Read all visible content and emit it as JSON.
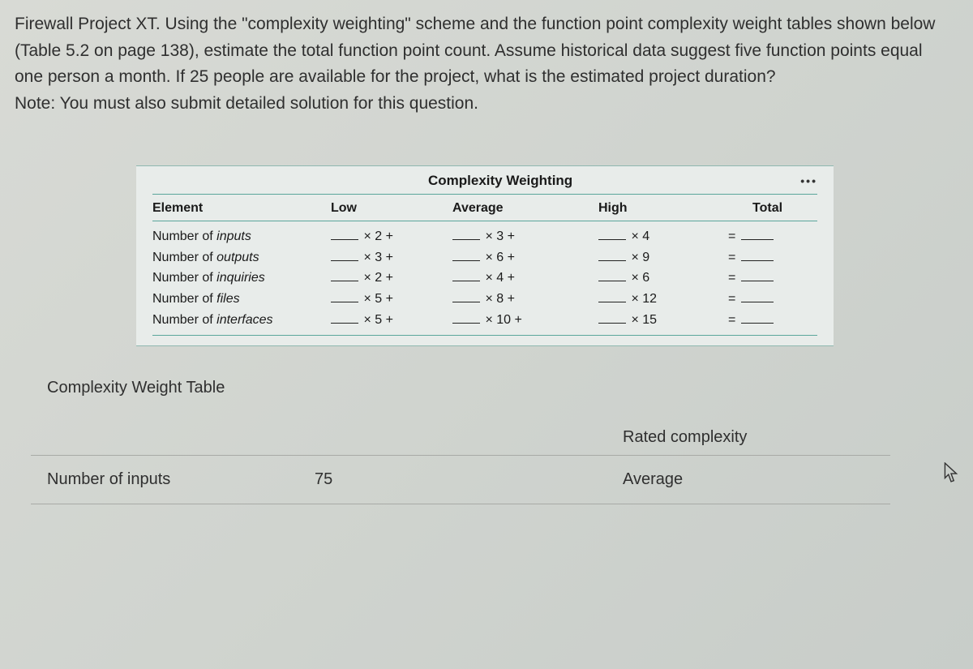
{
  "question": {
    "text": "Firewall Project XT. Using the \"complexity weighting\" scheme and the function point complexity weight tables shown below (Table 5.2 on page 138), estimate the total function point count. Assume historical data suggest five function points equal one person a month. If 25 people are available for the project, what is the estimated project duration?",
    "note": "Note: You must also submit detailed solution for this question."
  },
  "weight_table": {
    "title": "Complexity Weighting",
    "dots": "•••",
    "headers": {
      "element": "Element",
      "low": "Low",
      "average": "Average",
      "high": "High",
      "total": "Total"
    },
    "rows": [
      {
        "name_pre": "Number of ",
        "name_em": "inputs",
        "low": "× 2 +",
        "avg": "×  3 +",
        "high": "×  4"
      },
      {
        "name_pre": "Number of ",
        "name_em": "outputs",
        "low": "× 3 +",
        "avg": "×  6 +",
        "high": "×  9"
      },
      {
        "name_pre": "Number of ",
        "name_em": "inquiries",
        "low": "× 2 +",
        "avg": "×  4 +",
        "high": "×  6"
      },
      {
        "name_pre": "Number of ",
        "name_em": "files",
        "low": "× 5 +",
        "avg": "×  8 +",
        "high": "× 12"
      },
      {
        "name_pre": "Number of ",
        "name_em": "interfaces",
        "low": "× 5 +",
        "avg": "× 10 +",
        "high": "× 15"
      }
    ],
    "caption": "Complexity Weight Table"
  },
  "data_table": {
    "header_right": "Rated complexity",
    "rows": [
      {
        "label": "Number of inputs",
        "count": "75",
        "rated": "Average"
      }
    ]
  }
}
